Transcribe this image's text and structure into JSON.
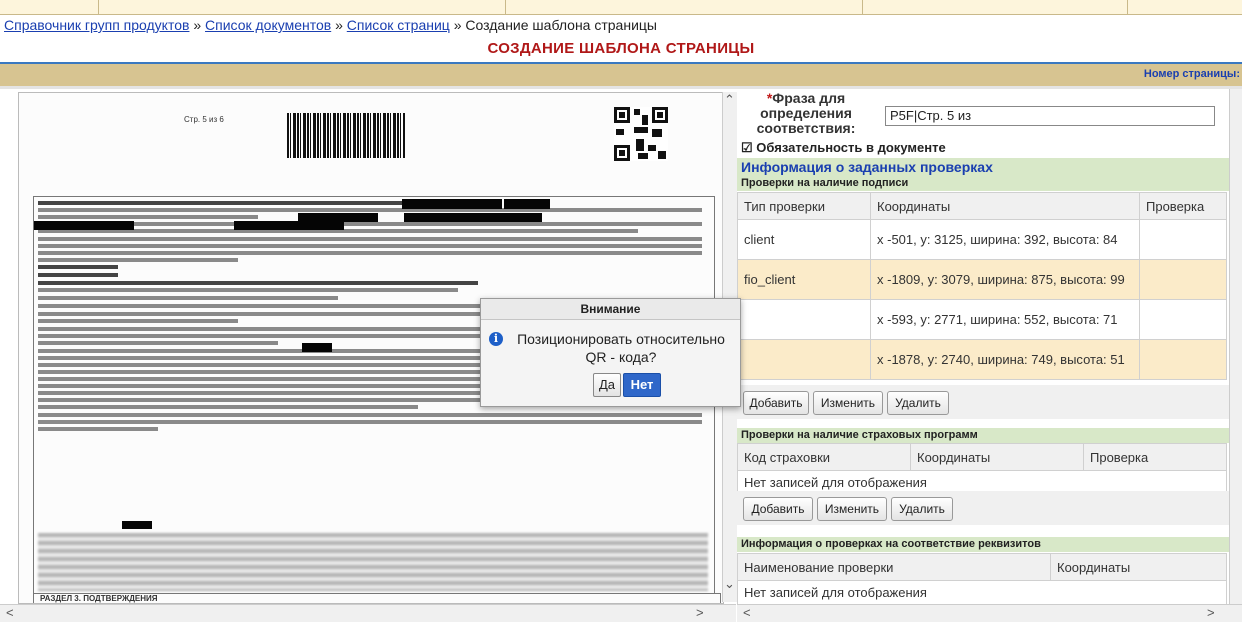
{
  "breadcrumbs": {
    "link1": "Справочник групп продуктов",
    "link2": "Список документов",
    "link3": "Список страниц",
    "current": "Создание шаблона страницы",
    "sep": " » "
  },
  "page_title": "СОЗДАНИЕ ШАБЛОНА СТРАНИЦЫ",
  "toolbar": {
    "page_number_label": "Номер страницы:"
  },
  "document": {
    "page_label": "Стр. 5 из 6",
    "section_label": "РАЗДЕЛ 3. ПОДТВЕРЖДЕНИЯ"
  },
  "form": {
    "phrase_label_star": "*",
    "phrase_label": "Фраза для определения соответствия:",
    "phrase_value": "P5F|Стр. 5 из",
    "required_label": "☑ Обязательность в документе",
    "checks_info_title": "Информация о заданных проверках"
  },
  "signature_checks": {
    "title": "Проверки на наличие подписи",
    "columns": [
      "Тип проверки",
      "Координаты",
      "Проверка"
    ],
    "rows": [
      {
        "type": "client",
        "coords": "x -501, y: 3125, ширина: 392, высота: 84"
      },
      {
        "type": "fio_client",
        "coords": "x -1809, y: 3079, ширина: 875, высота: 99"
      },
      {
        "type": "",
        "coords": "x -593, y: 2771, ширина: 552, высота: 71"
      },
      {
        "type": "",
        "coords": "x -1878, y: 2740, ширина: 749, высота: 51"
      }
    ],
    "buttons": {
      "add": "Добавить",
      "edit": "Изменить",
      "delete": "Удалить"
    }
  },
  "insurance_checks": {
    "title": "Проверки на наличие страховых программ",
    "columns": [
      "Код страховки",
      "Координаты",
      "Проверка"
    ],
    "empty": "Нет записей для отображения",
    "buttons": {
      "add": "Добавить",
      "edit": "Изменить",
      "delete": "Удалить"
    }
  },
  "requisite_checks": {
    "title": "Информация о проверках на соответствие реквизитов",
    "columns": [
      "Наименование проверки",
      "Координаты"
    ],
    "empty": "Нет записей для отображения"
  },
  "dialog": {
    "title": "Внимание",
    "message": "Позиционировать относительно QR - кода?",
    "yes": "Да",
    "no": "Нет"
  }
}
